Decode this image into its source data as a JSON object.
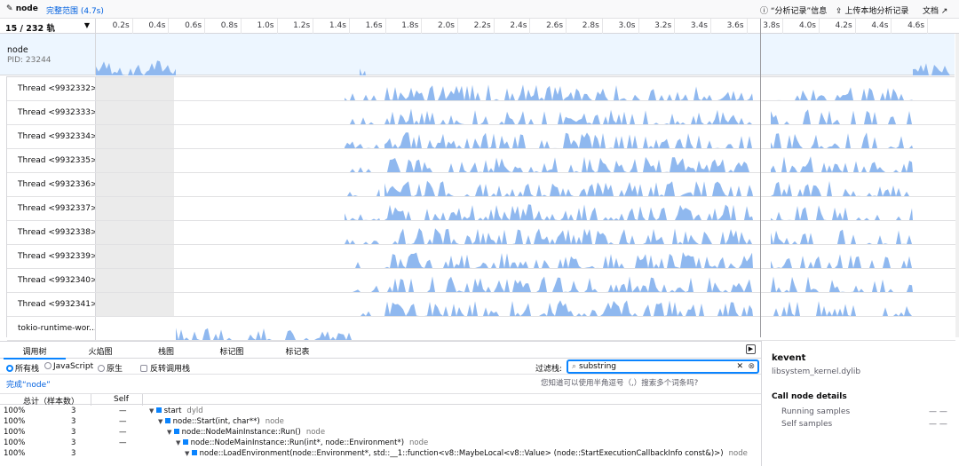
{
  "topbar": {
    "profile_name": "node",
    "full_range": "完整范围 (4.7s)",
    "upload_info": "“分析记录”信息",
    "upload_local": "上传本地分析记录",
    "docs": "文档"
  },
  "ruler": {
    "track_count": "15 / 232 轨",
    "ticks": [
      "0.2s",
      "0.4s",
      "0.6s",
      "0.8s",
      "1.0s",
      "1.2s",
      "1.4s",
      "1.6s",
      "1.8s",
      "2.0s",
      "2.2s",
      "2.4s",
      "2.6s",
      "2.8s",
      "3.0s",
      "3.2s",
      "3.4s",
      "3.6s",
      "3.8s",
      "4.0s",
      "4.2s",
      "4.4s",
      "4.6s"
    ]
  },
  "process": {
    "name": "node",
    "pid": "PID: 23244"
  },
  "threads": [
    "Thread <9932332>",
    "Thread <9932333>",
    "Thread <9932334>",
    "Thread <9932335>",
    "Thread <9932336>",
    "Thread <9932337>",
    "Thread <9932338>",
    "Thread <9932339>",
    "Thread <9932340>",
    "Thread <9932341>",
    "tokio-runtime-wor..."
  ],
  "tabs": [
    "调用树",
    "火焰图",
    "栈图",
    "标记图",
    "标记表"
  ],
  "options": {
    "all_stacks": "所有栈",
    "javascript": "JavaScript",
    "native": "原生",
    "invert": "反转调用栈",
    "filter_label": "过滤栈:",
    "filter_value": "substring",
    "hint": "您知道可以使用半角逗号（,）搜索多个词条吗?"
  },
  "breadcrumb": "完成“node”",
  "tree_header": {
    "total": "总计（样本数）",
    "self": "Self"
  },
  "tree_rows": [
    {
      "pct": "100%",
      "count": "3",
      "self": "—",
      "name": "start",
      "lib": "dyld",
      "indent": 0
    },
    {
      "pct": "100%",
      "count": "3",
      "self": "—",
      "name": "node::Start(int, char**)",
      "lib": "node",
      "indent": 1
    },
    {
      "pct": "100%",
      "count": "3",
      "self": "—",
      "name": "node::NodeMainInstance::Run()",
      "lib": "node",
      "indent": 2
    },
    {
      "pct": "100%",
      "count": "3",
      "self": "—",
      "name": "node::NodeMainInstance::Run(int*, node::Environment*)",
      "lib": "node",
      "indent": 3
    },
    {
      "pct": "100%",
      "count": "3",
      "self": "",
      "name": "node::LoadEnvironment(node::Environment*, std::__1::function<v8::MaybeLocal<v8::Value> (node::StartExecutionCallbackInfo const&)>)",
      "lib": "node",
      "indent": 4
    }
  ],
  "sidebar": {
    "func": "kevent",
    "lib": "libsystem_kernel.dylib",
    "details_title": "Call node details",
    "running": "Running samples",
    "running_val": "— —",
    "self": "Self samples",
    "self_val": "— —"
  },
  "colors": {
    "accent": "#0a84ff",
    "graph": "#8fb8ef"
  }
}
